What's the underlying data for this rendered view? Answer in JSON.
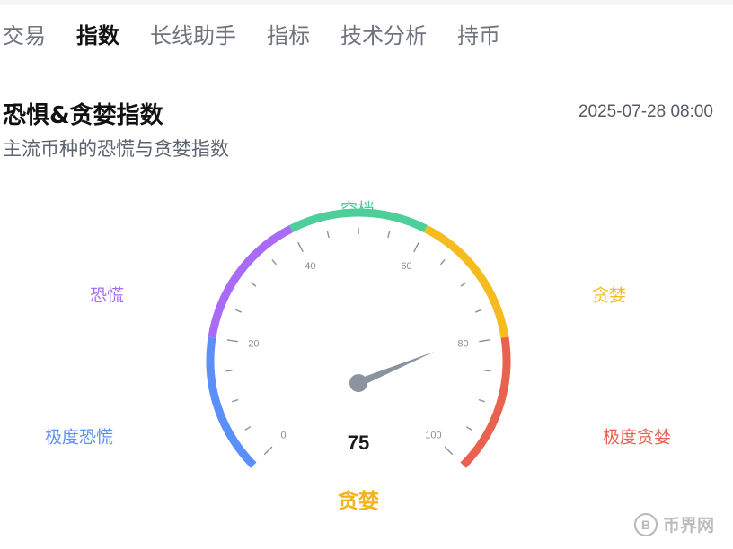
{
  "nav": {
    "tabs": [
      {
        "label": "交易",
        "active": false
      },
      {
        "label": "指数",
        "active": true
      },
      {
        "label": "长线助手",
        "active": false
      },
      {
        "label": "指标",
        "active": false
      },
      {
        "label": "技术分析",
        "active": false
      },
      {
        "label": "持币",
        "active": false
      }
    ]
  },
  "header": {
    "title": "恐惧&贪婪指数",
    "subtitle": "主流币种的恐慌与贪婪指数",
    "timestamp": "2025-07-28 08:00"
  },
  "gauge": {
    "min": 0,
    "max": 100,
    "value": 75,
    "value_text": "75",
    "status": "贪婪",
    "status_color": "#f6b31b",
    "tick_labels": [
      "0",
      "20",
      "40",
      "60",
      "80",
      "100"
    ],
    "zones": [
      {
        "label": "极度恐慌",
        "from": 0,
        "to": 20,
        "color": "#5b8ff9"
      },
      {
        "label": "恐慌",
        "from": 20,
        "to": 40,
        "color": "#a86bf5"
      },
      {
        "label": "空档",
        "from": 40,
        "to": 60,
        "color": "#4ecf9a"
      },
      {
        "label": "贪婪",
        "from": 60,
        "to": 80,
        "color": "#f6bb1e"
      },
      {
        "label": "极度贪婪",
        "from": 80,
        "to": 100,
        "color": "#e8624f"
      }
    ]
  },
  "watermark": {
    "logo_glyph": "B",
    "text": "币界网"
  }
}
